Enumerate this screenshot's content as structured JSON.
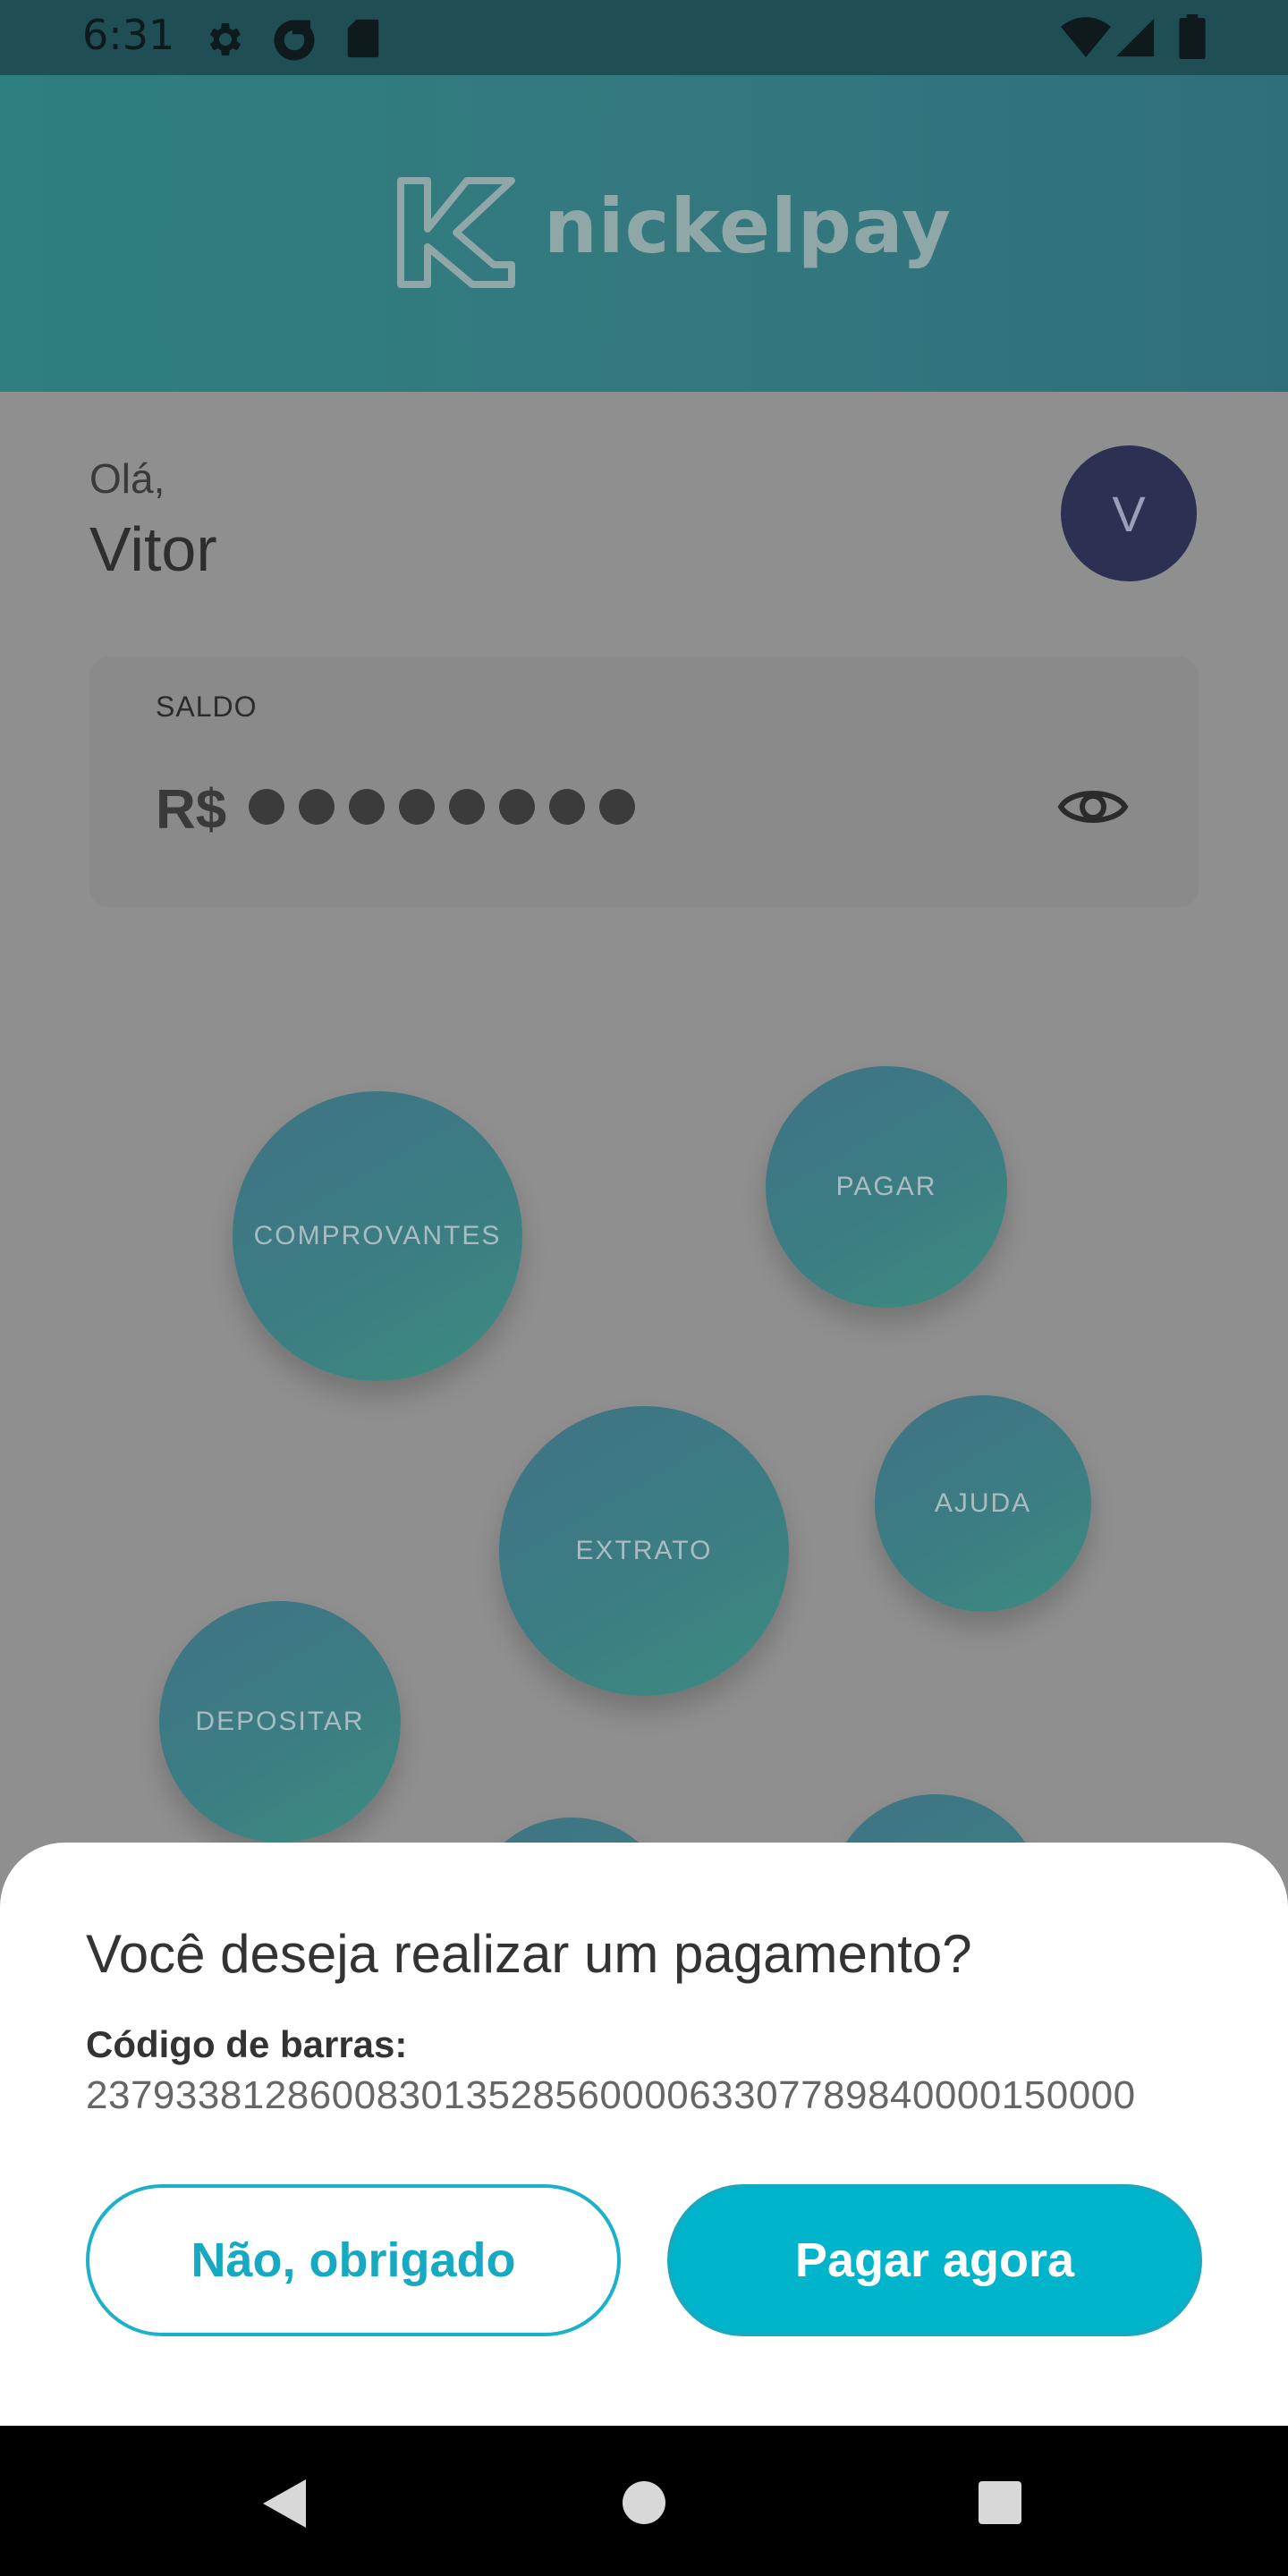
{
  "status_bar": {
    "time": "6:31",
    "left_icons": [
      "gear-icon",
      "sync-icon",
      "sd-card-icon"
    ],
    "right_icons": [
      "wifi-icon",
      "signal-icon",
      "battery-icon"
    ]
  },
  "header": {
    "brand": "nickelpay"
  },
  "greeting": {
    "hello": "Olá,",
    "name": "Vitor",
    "avatar_initial": "V"
  },
  "balance": {
    "label": "SALDO",
    "currency": "R$",
    "hidden_digits": 8
  },
  "actions": [
    {
      "label": "COMPROVANTES"
    },
    {
      "label": "PAGAR"
    },
    {
      "label": "EXTRATO"
    },
    {
      "label": "AJUDA"
    },
    {
      "label": "DEPOSITAR"
    }
  ],
  "dialog": {
    "title": "Você deseja realizar um pagamento?",
    "barcode_label": "Código de barras:",
    "barcode_value": "23793381286008301352856000063307789840000150000",
    "decline_label": "Não, obrigado",
    "confirm_label": "Pagar agora"
  },
  "colors": {
    "accent": "#00B5CB",
    "header": "#2E7F7F",
    "avatar": "#2C3153"
  }
}
